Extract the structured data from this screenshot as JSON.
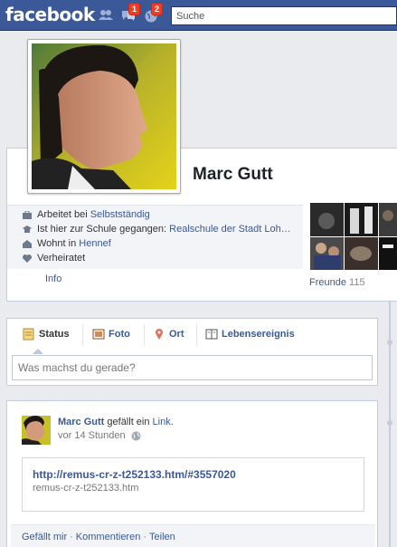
{
  "header": {
    "logo": "facebook",
    "search_placeholder": "Suche",
    "jewels": [
      {
        "icon": "friend-requests-icon",
        "count": ""
      },
      {
        "icon": "messages-icon",
        "count": "1"
      },
      {
        "icon": "notifications-globe-icon",
        "count": "2"
      }
    ]
  },
  "profile": {
    "name": "Marc Gutt",
    "info": [
      {
        "icon": "briefcase-icon",
        "prefix": "Arbeitet bei ",
        "link": "Selbstständig"
      },
      {
        "icon": "graduation-cap-icon",
        "prefix": "Ist hier zur Schule gegangen: ",
        "link": "Realschule der Stadt Loh…"
      },
      {
        "icon": "house-icon",
        "prefix": "Wohnt in ",
        "link": "Hennef"
      },
      {
        "icon": "heart-icon",
        "prefix": "Verheiratet",
        "link": ""
      }
    ],
    "info_link": "Info",
    "friends_label": "Freunde",
    "friends_count": "115"
  },
  "composer": {
    "tabs": [
      {
        "label": "Status",
        "icon": "status-pencil-icon",
        "active": true
      },
      {
        "label": "Foto",
        "icon": "photo-icon",
        "active": false
      },
      {
        "label": "Ort",
        "icon": "location-pin-icon",
        "active": false
      },
      {
        "label": "Lebensereignis",
        "icon": "life-event-book-icon",
        "active": false
      }
    ],
    "placeholder": "Was machst du gerade?"
  },
  "story": {
    "actor": "Marc Gutt",
    "verb": " gefällt ein ",
    "object": "Link",
    "object_suffix": ".",
    "time": "vor 14 Stunden",
    "link_title": "http://remus-cr-z-t252133.htm/#3557020",
    "link_url": "remus-cr-z-t252133.htm",
    "actions": [
      "Gefällt mir",
      "Kommentieren",
      "Teilen"
    ],
    "action_separator": "·"
  },
  "colors": {
    "brand": "#3b5998",
    "badge": "#f03d25",
    "background": "#e9ebee"
  }
}
